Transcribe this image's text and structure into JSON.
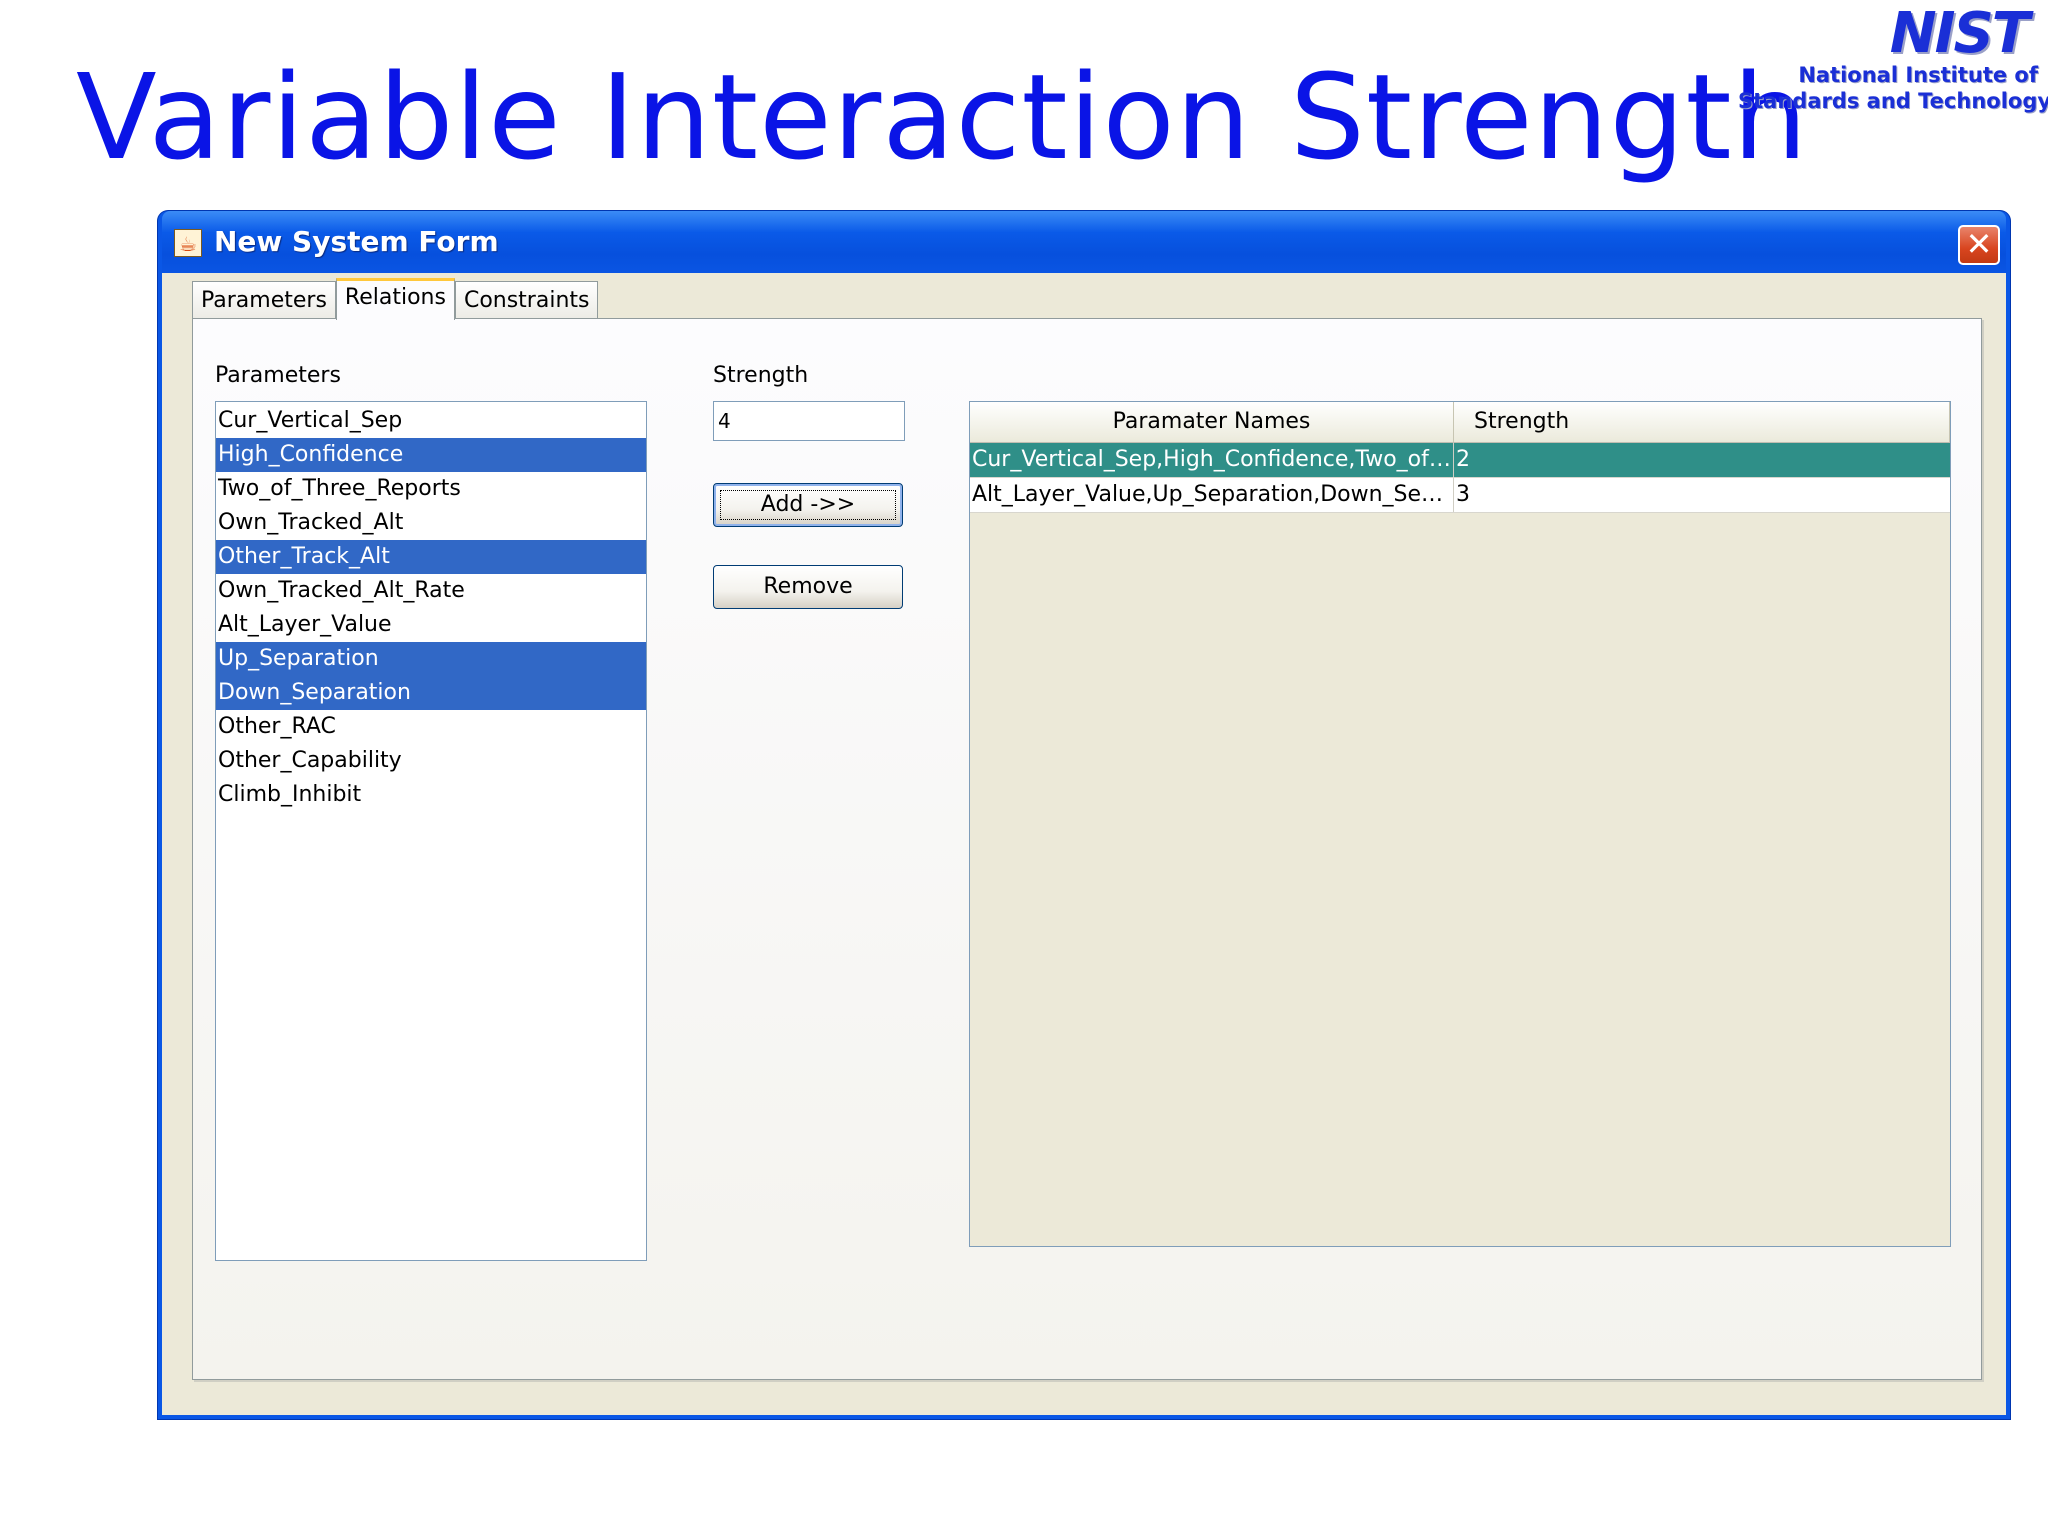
{
  "slide": {
    "title": "Variable Interaction Strength"
  },
  "logo": {
    "mark": "NIST",
    "line1": "National Institute of",
    "line2": "Standards and Technology"
  },
  "window": {
    "title": "New System Form",
    "icon": "java-cup-icon",
    "close_label": "✕"
  },
  "tabs": [
    {
      "label": "Parameters",
      "active": false
    },
    {
      "label": "Relations",
      "active": true
    },
    {
      "label": "Constraints",
      "active": false
    }
  ],
  "parameters": {
    "label": "Parameters",
    "items": [
      {
        "label": "Cur_Vertical_Sep",
        "selected": false
      },
      {
        "label": "High_Confidence",
        "selected": true
      },
      {
        "label": "Two_of_Three_Reports",
        "selected": false
      },
      {
        "label": "Own_Tracked_Alt",
        "selected": false
      },
      {
        "label": "Other_Track_Alt",
        "selected": true
      },
      {
        "label": "Own_Tracked_Alt_Rate",
        "selected": false
      },
      {
        "label": "Alt_Layer_Value",
        "selected": false
      },
      {
        "label": "Up_Separation",
        "selected": true
      },
      {
        "label": "Down_Separation",
        "selected": true
      },
      {
        "label": "Other_RAC",
        "selected": false
      },
      {
        "label": "Other_Capability",
        "selected": false
      },
      {
        "label": "Climb_Inhibit",
        "selected": false
      }
    ]
  },
  "strength": {
    "label": "Strength",
    "value": "4"
  },
  "buttons": {
    "add": "Add ->>",
    "remove": "Remove"
  },
  "table": {
    "columns": [
      "Paramater Names",
      "Strength"
    ],
    "rows": [
      {
        "names": "Cur_Vertical_Sep,High_Confidence,Two_of_...",
        "strength": "2",
        "selected": true
      },
      {
        "names": "Alt_Layer_Value,Up_Separation,Down_Sepa...",
        "strength": "3",
        "selected": false
      }
    ]
  },
  "colors": {
    "title_blue": "#0a14e6",
    "xp_titlebar": "#0a57e6",
    "selection_blue": "#3168c6",
    "table_selection": "#2f8f88",
    "window_bg": "#ece9d8"
  }
}
